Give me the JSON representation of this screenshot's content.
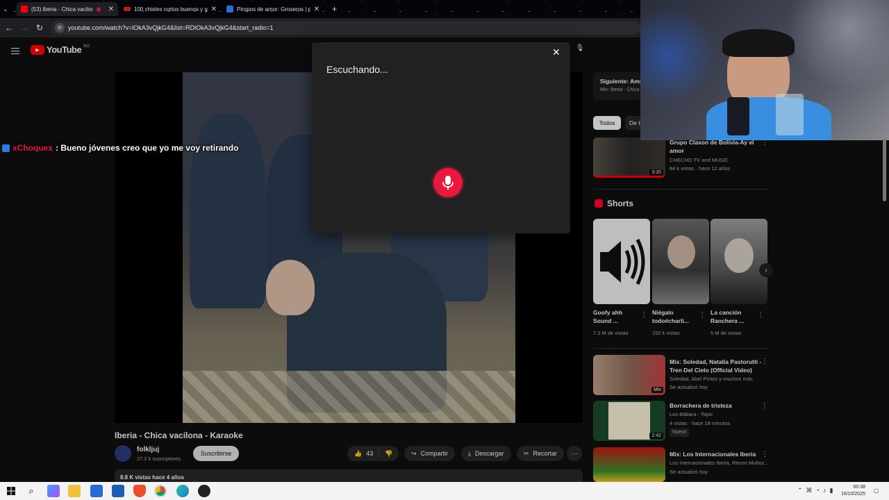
{
  "browser": {
    "tabs": [
      {
        "title": "(53) Iberia - Chica vacilona",
        "active": true
      },
      {
        "title": "100 chistes cortos buenos y gr",
        "active": false
      },
      {
        "title": "Piropos de amor: Groseros | pa",
        "active": false
      }
    ],
    "new_tab": "+",
    "url": "youtube.com/watch?v=lOkA3vQjkG4&list=RDlOkA3vQjkG4&start_radio=1"
  },
  "youtube": {
    "logo_text": "YouTube",
    "logo_badge": "BO",
    "video": {
      "title": "Iberia - Chica vacilona - Karaoke",
      "channel": "folkljuj",
      "subscribers": "27.2 k suscriptores",
      "subscribe_label": "Suscribirse",
      "likes": "43",
      "share_label": "Compartir",
      "download_label": "Descargar",
      "clip_label": "Recortar",
      "views_date": "8.8 K vistas  hace 4 años"
    },
    "voice_dialog": {
      "status": "Escuchando..."
    },
    "sidebar": {
      "next_up": "Siguiente: Amo",
      "next_sub": "Mix: Iberia - Chica",
      "chips": [
        "Todos",
        "De t"
      ],
      "top_video": {
        "title": "Grupo Claxon de Bolivia-Ay el amor",
        "channel": "CHECHO TV and MUSIC",
        "meta": "84 k vistas · hace 12 años",
        "duration": "3:20"
      },
      "shorts_title": "Shorts",
      "shorts": [
        {
          "title": "Goofy ahh Sound ...",
          "views": "7.2 M de vistas"
        },
        {
          "title": "Niégalo todo#charli...",
          "views": "152 k vistas"
        },
        {
          "title": "La canción Ranchera ...",
          "views": "5 M de vistas"
        }
      ],
      "videos": [
        {
          "title": "Mix: Soledad, Natalia Pastorutti - Tren Del Cielo (Official Video)",
          "line1": "Soledad, Abel Pintos y muchos más",
          "line2": "Se actualizó hoy",
          "badge": "Mix"
        },
        {
          "title": "Borrachera de tristeza",
          "line1": "Los Bábara - Topic",
          "line2": "4 vistas · hace 18 minutos",
          "badge": "Nuevo",
          "duration": "2:42"
        },
        {
          "title": "Mix: Los Internacionales Iberia",
          "line1": "Los Internacionales Iberia, Renzo Muñoz...",
          "line2": "Se actualizó hoy"
        }
      ]
    }
  },
  "chat": {
    "user": "xChoquex",
    "message": ": Bueno jóvenes creo que yo me voy retirando"
  },
  "taskbar": {
    "time": "00:38",
    "date": "16/10/2025"
  },
  "colors": {
    "youtube_red": "#ff0000",
    "mic_red": "#e8193c",
    "chat_user": "#e8193c"
  }
}
